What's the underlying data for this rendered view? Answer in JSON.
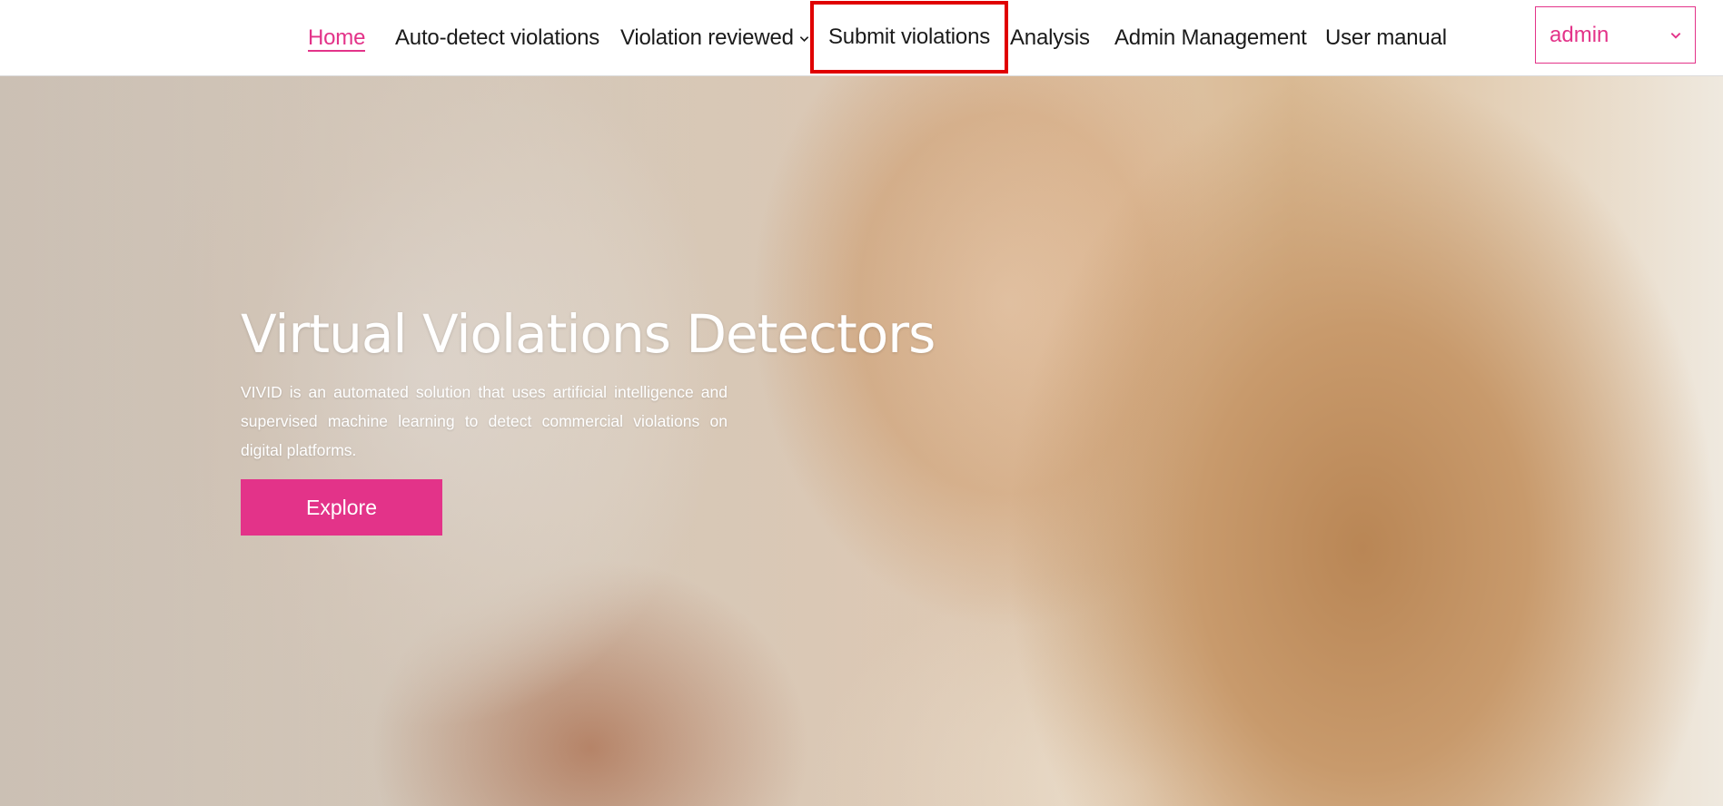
{
  "nav": {
    "items": [
      {
        "label": "Home",
        "active": true
      },
      {
        "label": "Auto-detect violations"
      },
      {
        "label": "Violation reviewed",
        "has_dropdown": true
      },
      {
        "label": "Submit violations",
        "highlighted": true
      },
      {
        "label": "Analysis"
      },
      {
        "label": "Admin Management"
      },
      {
        "label": "User manual"
      }
    ]
  },
  "user_menu": {
    "value": "admin",
    "icon": "chevron-down-icon"
  },
  "hero": {
    "title": "Virtual Violations Detectors",
    "description": "VIVID is an automated solution that uses artificial intelligence and supervised machine learning to detect commercial violations on digital platforms.",
    "button_label": "Explore"
  },
  "colors": {
    "accent": "#e33389",
    "highlight_outline": "#e00000"
  }
}
